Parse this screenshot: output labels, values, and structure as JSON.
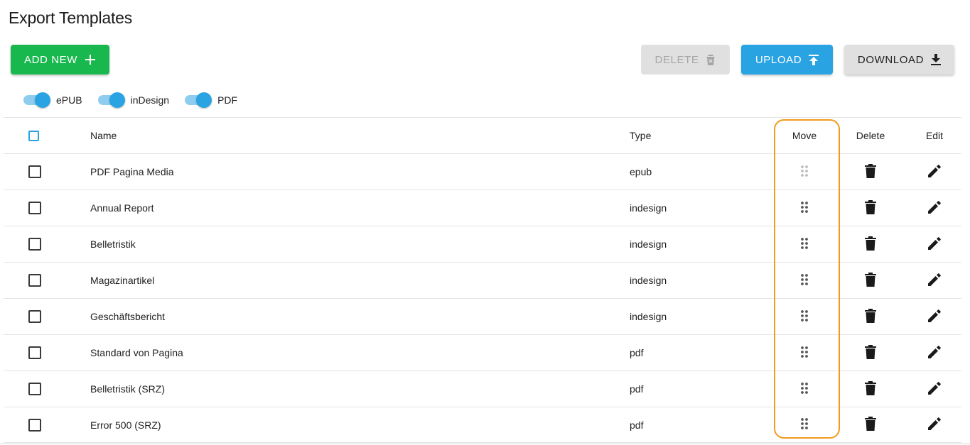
{
  "page": {
    "title": "Export Templates"
  },
  "toolbar": {
    "add_new": "ADD NEW",
    "delete": "DELETE",
    "upload": "UPLOAD",
    "download": "DOWNLOAD"
  },
  "filters": [
    {
      "label": "ePUB",
      "on": true
    },
    {
      "label": "inDesign",
      "on": true
    },
    {
      "label": "PDF",
      "on": true
    }
  ],
  "table": {
    "columns": {
      "name": "Name",
      "type": "Type",
      "move": "Move",
      "delete": "Delete",
      "edit": "Edit"
    },
    "rows": [
      {
        "name": "PDF Pagina Media",
        "type": "epub",
        "move_disabled": true
      },
      {
        "name": "Annual Report",
        "type": "indesign"
      },
      {
        "name": "Belletristik",
        "type": "indesign"
      },
      {
        "name": "Magazinartikel",
        "type": "indesign"
      },
      {
        "name": "Geschäftsbericht",
        "type": "indesign"
      },
      {
        "name": "Standard von Pagina",
        "type": "pdf"
      },
      {
        "name": "Belletristik (SRZ)",
        "type": "pdf"
      },
      {
        "name": "Error 500 (SRZ)",
        "type": "pdf"
      }
    ]
  },
  "colors": {
    "add": "#19b84f",
    "primary": "#2aa3e3",
    "disabled": "#e0e0e0",
    "highlight": "#f39a1e"
  },
  "icons": {
    "add": "plus-icon",
    "delete_toolbar": "delete-forever-icon",
    "upload": "upload-icon",
    "download": "download-icon",
    "move": "drag-handle-icon",
    "delete_row": "trash-icon",
    "edit_row": "pencil-icon"
  }
}
